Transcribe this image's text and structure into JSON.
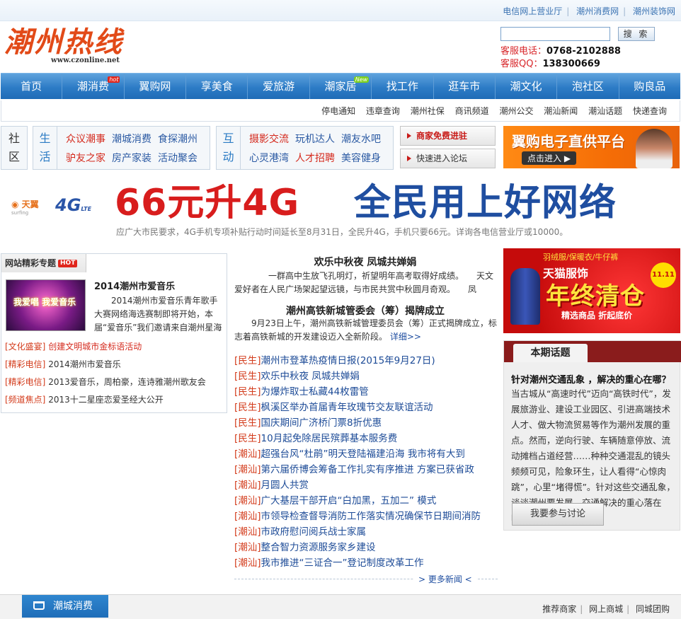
{
  "top_links": [
    "电信网上营业厅",
    "潮州消费网",
    "潮州装饰网"
  ],
  "logo": {
    "text": "潮州热线",
    "url": "www.czonline.net"
  },
  "search": {
    "button": "搜 索",
    "value": ""
  },
  "contact": {
    "phone_label": "客服电话：",
    "phone": "0768-2102888",
    "qq_label": "客服QQ：",
    "qq": "138300669"
  },
  "nav": [
    {
      "label": "首页"
    },
    {
      "label": "潮消费",
      "badge": "hot"
    },
    {
      "label": "翼购网"
    },
    {
      "label": "享美食"
    },
    {
      "label": "爱旅游"
    },
    {
      "label": "潮家居",
      "badge": "New"
    },
    {
      "label": "找工作"
    },
    {
      "label": "逛车市"
    },
    {
      "label": "潮文化"
    },
    {
      "label": "泡社区"
    },
    {
      "label": "购良品"
    }
  ],
  "subnav": [
    "停电通知",
    "违章查询",
    "潮州社保",
    "商讯频道",
    "潮州公交",
    "潮汕新闻",
    "潮汕话题",
    "快递查询"
  ],
  "community": {
    "label1": "社",
    "label2": "区",
    "life_a": "生",
    "life_b": "活",
    "life_links": [
      [
        "众议潮事",
        "潮城消费",
        "食探潮州"
      ],
      [
        "驴友之家",
        "房产家装",
        "活动聚会"
      ]
    ],
    "inter_a": "互",
    "inter_b": "动",
    "inter_links": [
      [
        "摄影交流",
        "玩机达人",
        "潮友水吧"
      ],
      [
        "心灵港湾",
        "人才招聘",
        "美容健身"
      ]
    ],
    "btn_merchant": "商家免费进驻",
    "btn_forum": "快速进入论坛"
  },
  "ad_dian": {
    "title": "翼购电子直供平台",
    "cta": "点击进入 ▶"
  },
  "banner": {
    "brand": "天翼",
    "brand_sub": "surfing",
    "brand_tag": "4G",
    "red": "66元升4G",
    "blue": "全民用上好网络",
    "note": "应广大市民要求，4G手机专项补贴行动时间延长至8月31日，全民升4G，手机只要66元。详询各电信营业厅或10000。"
  },
  "special": {
    "head": "网站精彩专题",
    "hot": "HOT",
    "thumb_text": "我爱唱 我爱音乐",
    "title": "2014潮州市爱音乐",
    "desc": "2014潮州市爱音乐青年歌手大赛网络海选赛制即将开始，本届“爱音乐”我们邀请来自潮州星海",
    "items": [
      {
        "tag": "[文化盛宴]",
        "text": "创建文明城市金标语活动",
        "red": true
      },
      {
        "tag": "[精彩电信]",
        "text": "2014潮州市爱音乐",
        "red": false
      },
      {
        "tag": "[精彩电信]",
        "text": "2013爱音乐，周柏豪，连诗雅潮州歌友会",
        "red": false
      },
      {
        "tag": "[频道焦点]",
        "text": "2013十二星座恋爱圣经大公开",
        "red": false
      }
    ]
  },
  "headline1": {
    "title": "欢乐中秋夜 凤城共婵娟",
    "desc": "一群高中生放飞孔明灯，祈望明年高考取得好成绩。　　天文爱好者在人民广场架起望远镜，与市民共赏中秋圆月奇观。　　凤"
  },
  "headline2": {
    "title": "潮州高铁新城管委会（筹）揭牌成立",
    "desc": "9月23日上午，潮州高铁新城管理委员会（筹）正式揭牌成立，标志着高铁新城的开发建设迈入全新阶段。",
    "more": "详细>>"
  },
  "news": [
    {
      "tag": "[民生]",
      "title": "潮州市登革热疫情日报(2015年9月27日)"
    },
    {
      "tag": "[民生]",
      "title": "欢乐中秋夜 凤城共婵娟"
    },
    {
      "tag": "[民生]",
      "title": "为爆炸取士私藏44枚雷管"
    },
    {
      "tag": "[民生]",
      "title": "枫溪区举办首届青年玫瑰节交友联谊活动"
    },
    {
      "tag": "[民生]",
      "title": "国庆期间广济桥门票8折优惠"
    },
    {
      "tag": "[民生]",
      "title": "10月起免除居民殡葬基本服务费"
    },
    {
      "tag": "[潮汕]",
      "title": "超强台风“杜鹃”明天登陆福建沿海 我市将有大到"
    },
    {
      "tag": "[潮汕]",
      "title": "第六届侨博会筹备工作扎实有序推进 方案已获省政"
    },
    {
      "tag": "[潮汕]",
      "title": "月圆人共赏"
    },
    {
      "tag": "[潮汕]",
      "title": "广大基层干部开启“白加黑，五加二” 模式"
    },
    {
      "tag": "[潮汕]",
      "title": "市领导检查督导消防工作落实情况确保节日期间消防"
    },
    {
      "tag": "[潮汕]",
      "title": "市政府慰问阅兵战士家属"
    },
    {
      "tag": "[潮汕]",
      "title": "整合智力资源服务家乡建设"
    },
    {
      "tag": "[潮汕]",
      "title": "我市推进“三证合一”登记制度改革工作"
    }
  ],
  "more_news": "> 更多新闻 <",
  "ad_tmall": {
    "h1": "羽绒服/保暖衣/牛仔裤",
    "h2": "天猫服饰",
    "h3": "年终清仓",
    "h4": "精选商品 折起底价",
    "tag": "11.11"
  },
  "topic": {
    "head": "本期话题",
    "question": "针对潮州交通乱象 ，解决的重心在哪？",
    "body": "当古城从“高速时代”迈向“高铁时代”，发展旅游业、建设工业园区、引进高端技术人才、做大物流贸易等作为潮州发展的重点。然而，逆向行驶、车辆随意停放、流动摊档占道经营……种种交通混乱的镜头频频可见，险象环生，让人看得“心惊肉跳”，心里“堵得慌”。针对这些交通乱象，谈谈潮州要发展，交通解决的重心落在哪？",
    "button": "我要参与讨论"
  },
  "footer": {
    "tab": "潮城消费",
    "links": [
      "推荐商家",
      "网上商城",
      "同城团购"
    ]
  },
  "colors": {
    "nav_blue": "#2d7cc6",
    "accent_red": "#d52b1e",
    "link_blue": "#1d4b97",
    "topic_dark_red": "#8a1c1c"
  }
}
